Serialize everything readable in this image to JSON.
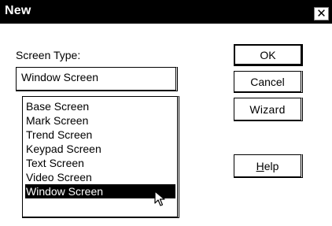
{
  "window": {
    "title": "New",
    "close_glyph": "✕"
  },
  "form": {
    "screen_type_label": "Screen Type:",
    "screen_type_value": "Window Screen"
  },
  "list": {
    "items": [
      "Base Screen",
      "Mark Screen",
      "Trend Screen",
      "Keypad Screen",
      "Text Screen",
      "Video Screen",
      "Window Screen"
    ],
    "selected_item": "Window Screen"
  },
  "buttons": {
    "ok": "OK",
    "cancel": "Cancel",
    "wizard": "Wizard",
    "help_prefix": "",
    "help_mnemonic": "H",
    "help_rest": "elp"
  },
  "icons": {
    "cursor": "arrow-pointer-icon",
    "close": "close-icon"
  }
}
